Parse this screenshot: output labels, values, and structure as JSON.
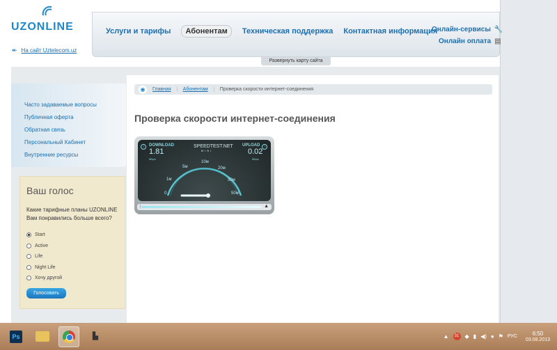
{
  "header": {
    "logo_text": "UZONLINE",
    "back_link": "На сайт Uztelecom.uz",
    "nav": [
      {
        "label": "Услуги и тарифы",
        "active": false
      },
      {
        "label": "Абонентам",
        "active": true
      },
      {
        "label": "Техническая поддержка",
        "active": false
      },
      {
        "label": "Контактная информация",
        "active": false
      }
    ],
    "online_services": "Онлайн-сервисы",
    "online_payment": "Онлайн оплата",
    "sitemap_button": "Развернуть карту сайта"
  },
  "sidebar": {
    "items": [
      {
        "label": "Часто задаваемые вопросы"
      },
      {
        "label": "Публичная оферта"
      },
      {
        "label": "Обратная связь"
      },
      {
        "label": "Персональный Кабинет"
      },
      {
        "label": "Внутренние ресурсы"
      }
    ]
  },
  "poll": {
    "title": "Ваш голос",
    "question": "Какие тарифные планы UZONLINE Вам понравились больше всего?",
    "options": [
      {
        "label": "Start",
        "selected": true
      },
      {
        "label": "Active",
        "selected": false
      },
      {
        "label": "Life",
        "selected": false
      },
      {
        "label": "Night Life",
        "selected": false
      },
      {
        "label": "Хочу другой",
        "selected": false
      }
    ],
    "button": "Голосовать"
  },
  "breadcrumb": {
    "items": [
      "Главная",
      "Абонентам",
      "Проверка скорости интернет-соединения"
    ]
  },
  "main": {
    "title": "Проверка скорости интернет-соединения"
  },
  "speedtest": {
    "brand": "SPEEDTEST.NET",
    "brand_sub": "MINI",
    "download_label": "DOWNLOAD",
    "download_value": "1.81",
    "download_unit": "Mbps",
    "upload_label": "UPLOAD",
    "upload_value": "0.02",
    "upload_unit": "Mbps",
    "ticks": [
      "0",
      "1м",
      "5м",
      "10м",
      "20м",
      "30м",
      "50м"
    ],
    "progress": 0.98
  },
  "taskbar": {
    "apps": [
      {
        "name": "photoshop",
        "label": "Ps",
        "active": false
      },
      {
        "name": "explorer",
        "label": "",
        "active": false
      },
      {
        "name": "chrome",
        "label": "",
        "active": true
      },
      {
        "name": "world-of-tanks",
        "label": "",
        "active": false
      }
    ],
    "tray_badge": "31",
    "language": "РУС",
    "time": "6:50",
    "date": "03.08.2013"
  }
}
